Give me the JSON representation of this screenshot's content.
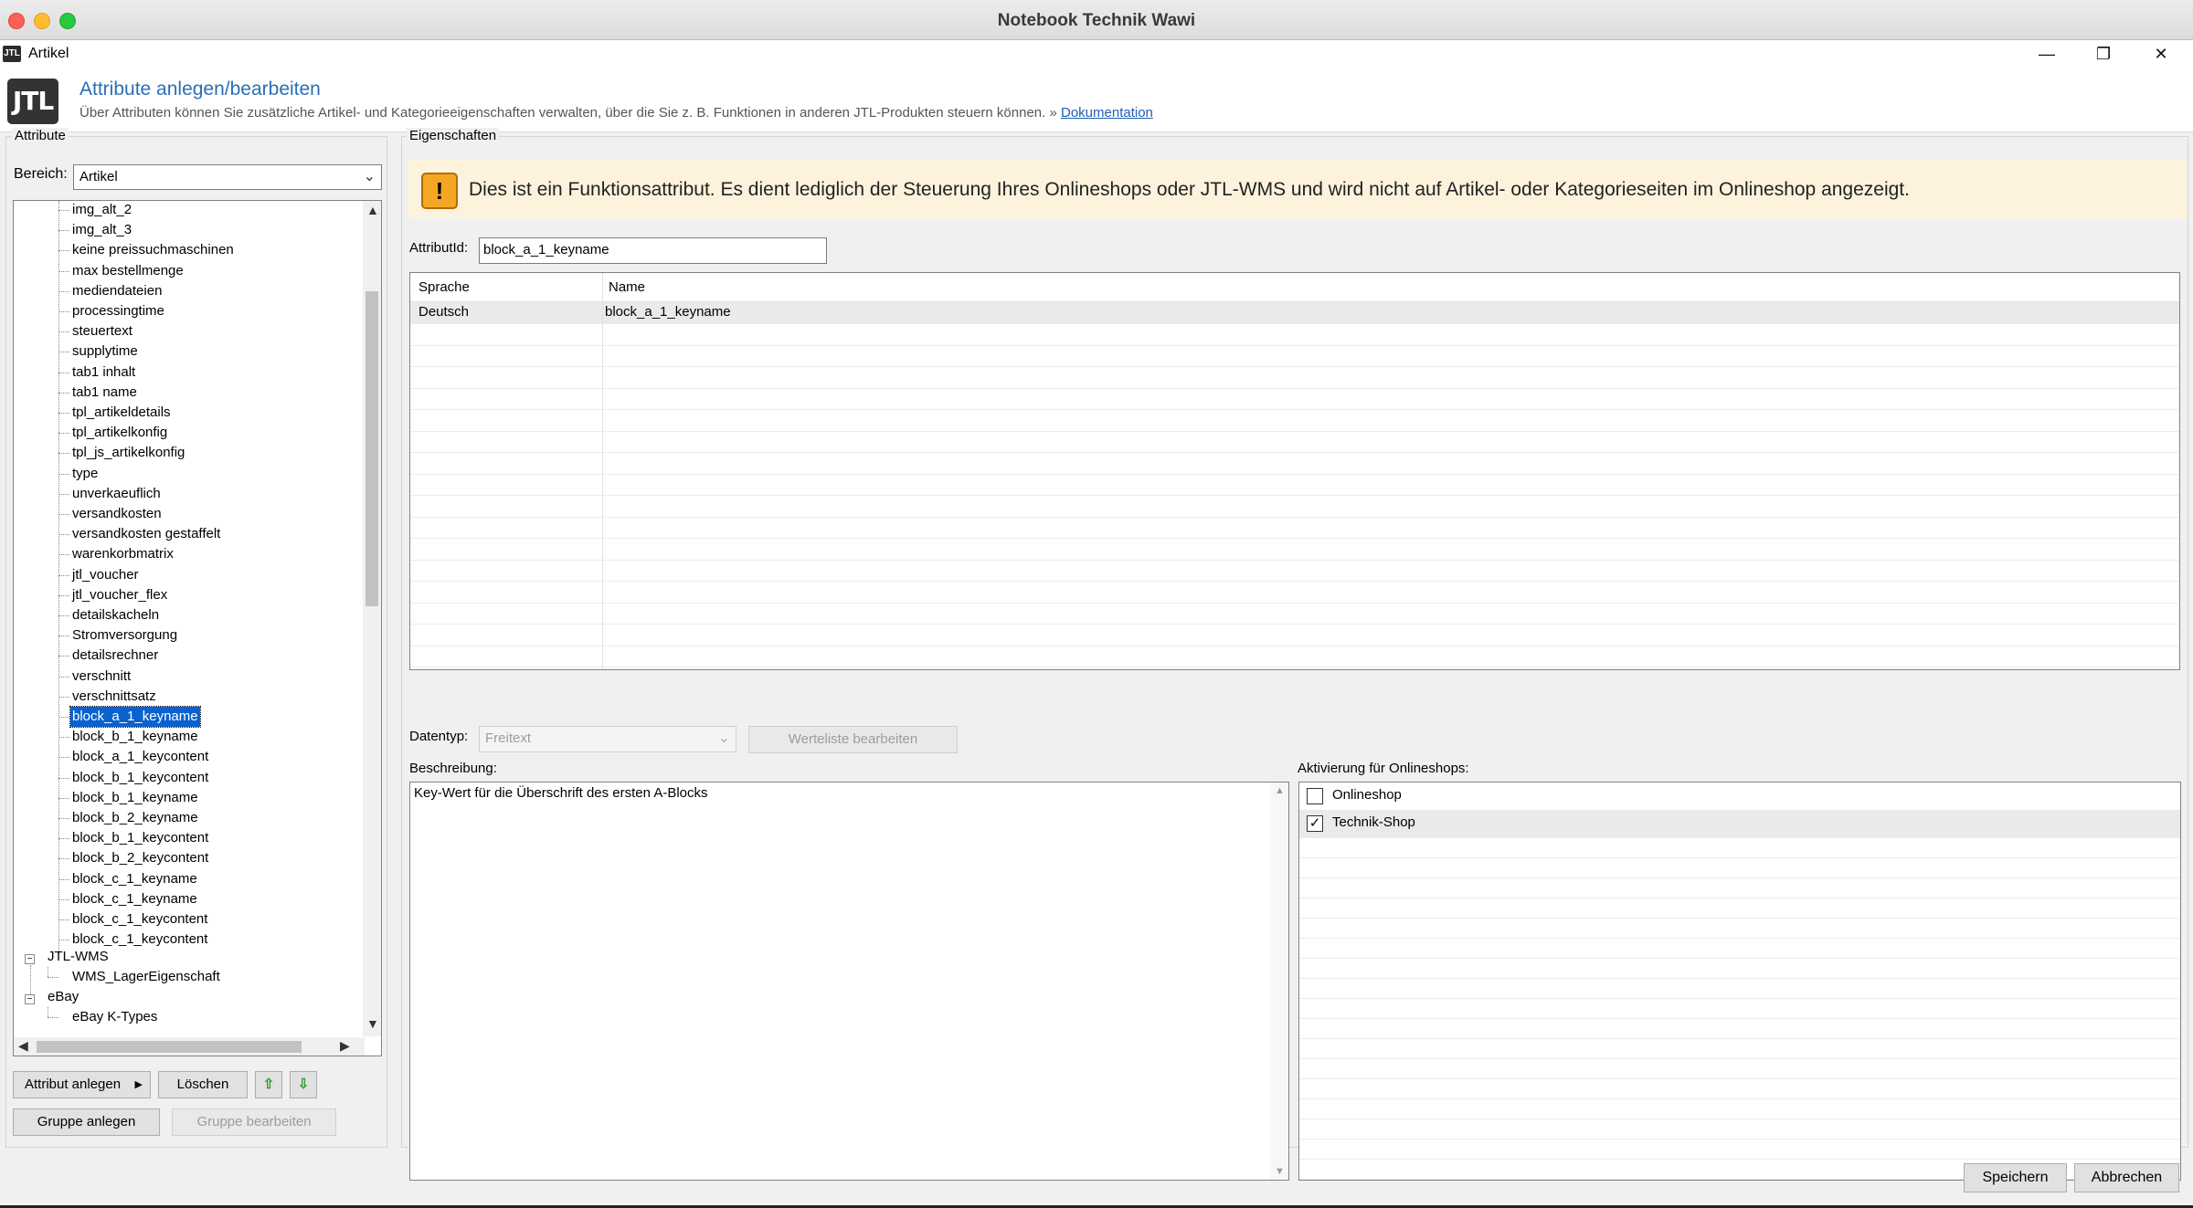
{
  "os_window": {
    "title": "Notebook Technik Wawi"
  },
  "window": {
    "icon_text": "JTL",
    "title": "Artikel",
    "controls": {
      "minimize": "—",
      "restore": "❐",
      "close": "✕"
    }
  },
  "header": {
    "logo_text": "JTL",
    "title": "Attribute anlegen/bearbeiten",
    "subtitle": "Über Attributen können Sie zusätzliche Artikel- und Kategorieeigenschaften verwalten, über die Sie z. B. Funktionen in anderen JTL-Produkten steuern können.",
    "link_prefix": "»",
    "link_text": "Dokumentation"
  },
  "left_panel": {
    "group_label": "Attribute",
    "bereich_label": "Bereich:",
    "bereich_value": "Artikel",
    "tree_items": [
      "img_alt_2",
      "img_alt_3",
      "keine preissuchmaschinen",
      "max bestellmenge",
      "mediendateien",
      "processingtime",
      "steuertext",
      "supplytime",
      "tab1 inhalt",
      "tab1 name",
      "tpl_artikeldetails",
      "tpl_artikelkonfig",
      "tpl_js_artikelkonfig",
      "type",
      "unverkaeuflich",
      "versandkosten",
      "versandkosten gestaffelt",
      "warenkorbmatrix",
      "jtl_voucher",
      "jtl_voucher_flex",
      "detailskacheln",
      "Stromversorgung",
      "detailsrechner",
      "verschnitt",
      "verschnittsatz",
      "block_a_1_keyname",
      "block_b_1_keyname",
      "block_a_1_keycontent",
      "block_b_1_keycontent",
      "block_b_1_keyname",
      "block_b_2_keyname",
      "block_b_1_keycontent",
      "block_b_2_keycontent",
      "block_c_1_keyname",
      "block_c_1_keyname",
      "block_c_1_keycontent",
      "block_c_1_keycontent"
    ],
    "selected_item": "block_a_1_keyname",
    "group_wms": "JTL-WMS",
    "wms_child": "WMS_LagerEigenschaft",
    "group_ebay": "eBay",
    "ebay_child": "eBay K-Types",
    "buttons": {
      "attribut_anlegen": "Attribut anlegen",
      "loeschen": "Löschen",
      "gruppe_anlegen": "Gruppe anlegen",
      "gruppe_bearbeiten": "Gruppe bearbeiten"
    }
  },
  "right_panel": {
    "group_label": "Eigenschaften",
    "warning_icon": "!",
    "warning": "Dies ist ein Funktionsattribut. Es dient lediglich der Steuerung Ihres Onlineshops oder JTL-WMS und wird nicht auf Artikel- oder Kategorieseiten im Onlineshop angezeigt.",
    "attribut_id_label": "AttributId:",
    "attribut_id_value": "block_a_1_keyname",
    "grid_headers": {
      "sprache": "Sprache",
      "name": "Name"
    },
    "grid_rows": [
      {
        "sprache": "Deutsch",
        "name": "block_a_1_keyname"
      }
    ],
    "datentyp_label": "Datentyp:",
    "datentyp_value": "Freitext",
    "werteliste_button": "Werteliste bearbeiten",
    "beschreibung_label": "Beschreibung:",
    "beschreibung_value": "Key-Wert für die Überschrift des ersten A-Blocks",
    "aktivierung_label": "Aktivierung für Onlineshops:",
    "shops": [
      {
        "name": "Onlineshop",
        "checked": false
      },
      {
        "name": "Technik-Shop",
        "checked": true
      }
    ]
  },
  "footer": {
    "save": "Speichern",
    "cancel": "Abbrechen"
  }
}
